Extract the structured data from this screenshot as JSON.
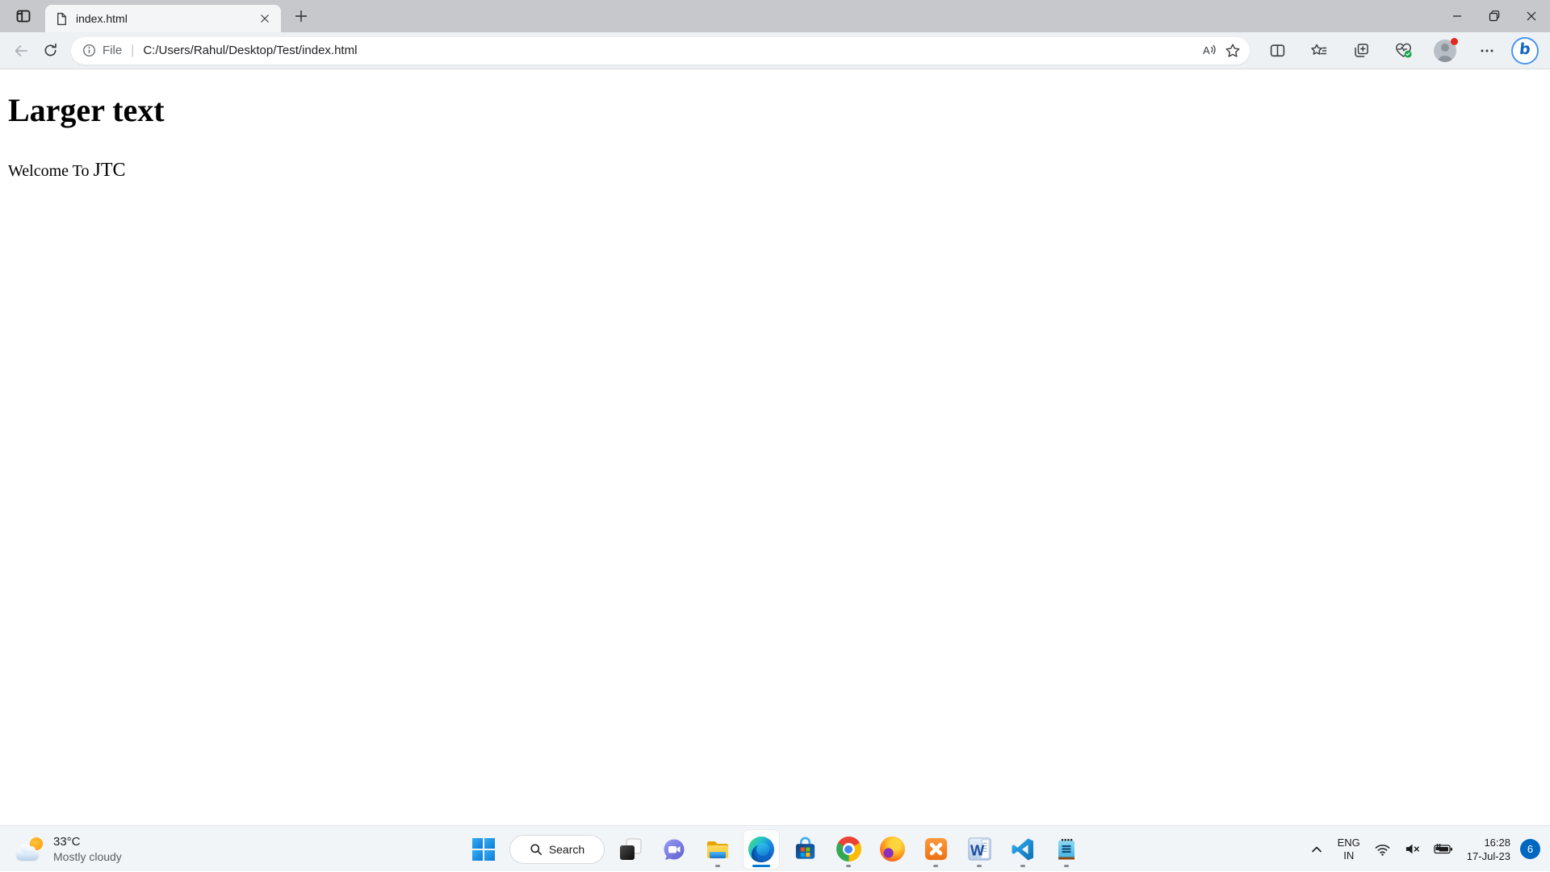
{
  "browser": {
    "tab_title": "index.html",
    "address": {
      "scheme_label": "File",
      "url": "C:/Users/Rahul/Desktop/Test/index.html"
    }
  },
  "page": {
    "heading": "Larger text",
    "welcome_prefix": "Welcome To ",
    "welcome_emphasis": "JTC"
  },
  "taskbar": {
    "weather": {
      "temperature": "33°C",
      "condition": "Mostly cloudy"
    },
    "search_label": "Search",
    "apps": [
      {
        "name": "start",
        "running": false
      },
      {
        "name": "search",
        "running": false
      },
      {
        "name": "task-view",
        "running": false
      },
      {
        "name": "chat",
        "running": false
      },
      {
        "name": "file-explorer",
        "running": true
      },
      {
        "name": "edge",
        "running": true,
        "active": true
      },
      {
        "name": "microsoft-store",
        "running": false
      },
      {
        "name": "chrome",
        "running": true
      },
      {
        "name": "firefox",
        "running": false
      },
      {
        "name": "xampp",
        "running": true
      },
      {
        "name": "word",
        "running": true
      },
      {
        "name": "vscode",
        "running": true
      },
      {
        "name": "notepad",
        "running": true
      }
    ],
    "tray": {
      "language_top": "ENG",
      "language_bottom": "IN",
      "time": "16:28",
      "date": "17-Jul-23",
      "notification_count": "6"
    }
  },
  "icons": {
    "tab-actions-menu-icon": "window-with-sidebar",
    "page-icon": "document",
    "close-icon": "x",
    "new-tab-icon": "plus",
    "minimize-icon": "horizontal-line",
    "restore-icon": "overlapping-squares",
    "back-icon": "left-arrow",
    "refresh-icon": "circular-arrow",
    "info-icon": "circled-i",
    "read-aloud-icon": "A-with-sound-waves",
    "favorite-star-icon": "star-outline",
    "split-screen-icon": "split-rectangle",
    "favorites-icon": "star-with-lines",
    "collections-icon": "stacked-squares-plus",
    "browser-essentials-icon": "heart-pulse-check",
    "profile-icon": "person-avatar-red-dot",
    "more-icon": "ellipsis",
    "bing-chat-icon": "blue-b-circle",
    "weather-icon": "sun-behind-cloud",
    "windows-start-icon": "four-blue-squares",
    "search-icon": "magnifier",
    "task-view-icon": "overlapping-squares",
    "chat-icon": "purple-video-bubble",
    "file-explorer-icon": "yellow-folder",
    "edge-icon": "blue-green-swirl",
    "store-icon": "blue-bag-colored-grid",
    "chrome-icon": "red-yellow-green-ring-blue-core",
    "firefox-icon": "orange-flame-sphere",
    "xampp-icon": "orange-square-white-x",
    "word-icon": "blue-w-document",
    "vscode-icon": "blue-angular-ribbon",
    "notepad-icon": "cyan-notepad-lines",
    "tray-chevron-icon": "chevron-up",
    "wifi-icon": "wifi-arcs",
    "volume-muted-icon": "speaker-x",
    "battery-icon": "battery-charging"
  },
  "colors": {
    "accent_blue": "#0078d4",
    "badge_blue": "#0067c0",
    "notification_red": "#e0281e",
    "tabstrip_gray": "#c6c8cb",
    "toolbar_gray": "#eef1f4",
    "taskbar_gray": "#f2f5f8"
  }
}
